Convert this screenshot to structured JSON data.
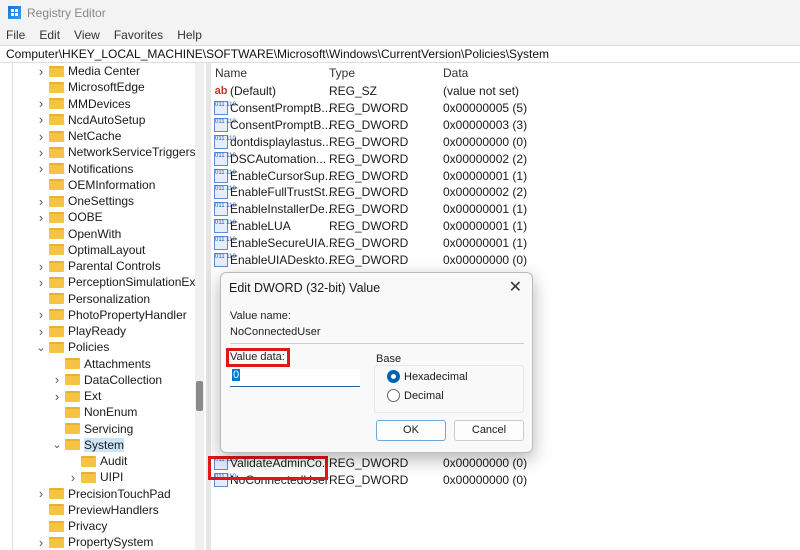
{
  "window": {
    "title": "Registry Editor"
  },
  "menu": [
    "File",
    "Edit",
    "View",
    "Favorites",
    "Help"
  ],
  "address": "Computer\\HKEY_LOCAL_MACHINE\\SOFTWARE\\Microsoft\\Windows\\CurrentVersion\\Policies\\System",
  "tree": [
    {
      "label": "Media Center",
      "level": 1,
      "chevron": ">"
    },
    {
      "label": "MicrosoftEdge",
      "level": 1,
      "chevron": ""
    },
    {
      "label": "MMDevices",
      "level": 1,
      "chevron": ">"
    },
    {
      "label": "NcdAutoSetup",
      "level": 1,
      "chevron": ">"
    },
    {
      "label": "NetCache",
      "level": 1,
      "chevron": ">"
    },
    {
      "label": "NetworkServiceTriggers",
      "level": 1,
      "chevron": ">"
    },
    {
      "label": "Notifications",
      "level": 1,
      "chevron": ">"
    },
    {
      "label": "OEMInformation",
      "level": 1,
      "chevron": ""
    },
    {
      "label": "OneSettings",
      "level": 1,
      "chevron": ">"
    },
    {
      "label": "OOBE",
      "level": 1,
      "chevron": ">"
    },
    {
      "label": "OpenWith",
      "level": 1,
      "chevron": ""
    },
    {
      "label": "OptimalLayout",
      "level": 1,
      "chevron": ""
    },
    {
      "label": "Parental Controls",
      "level": 1,
      "chevron": ">"
    },
    {
      "label": "PerceptionSimulationExt",
      "level": 1,
      "chevron": ">"
    },
    {
      "label": "Personalization",
      "level": 1,
      "chevron": ""
    },
    {
      "label": "PhotoPropertyHandler",
      "level": 1,
      "chevron": ">"
    },
    {
      "label": "PlayReady",
      "level": 1,
      "chevron": ">"
    },
    {
      "label": "Policies",
      "level": 1,
      "chevron": "v"
    },
    {
      "label": "Attachments",
      "level": 2,
      "chevron": ""
    },
    {
      "label": "DataCollection",
      "level": 2,
      "chevron": ">"
    },
    {
      "label": "Ext",
      "level": 2,
      "chevron": ">"
    },
    {
      "label": "NonEnum",
      "level": 2,
      "chevron": ""
    },
    {
      "label": "Servicing",
      "level": 2,
      "chevron": ""
    },
    {
      "label": "System",
      "level": 2,
      "chevron": "v",
      "selected": true
    },
    {
      "label": "Audit",
      "level": 3,
      "chevron": ""
    },
    {
      "label": "UIPI",
      "level": 3,
      "chevron": ">"
    },
    {
      "label": "PrecisionTouchPad",
      "level": 1,
      "chevron": ">"
    },
    {
      "label": "PreviewHandlers",
      "level": 1,
      "chevron": ""
    },
    {
      "label": "Privacy",
      "level": 1,
      "chevron": ""
    },
    {
      "label": "PropertySystem",
      "level": 1,
      "chevron": ">"
    }
  ],
  "list": {
    "headers": {
      "name": "Name",
      "type": "Type",
      "data": "Data"
    },
    "rows": [
      {
        "name": "(Default)",
        "type": "REG_SZ",
        "data": "(value not set)",
        "icon": "sz"
      },
      {
        "name": "ConsentPromptB...",
        "type": "REG_DWORD",
        "data": "0x00000005 (5)",
        "icon": "dw"
      },
      {
        "name": "ConsentPromptB...",
        "type": "REG_DWORD",
        "data": "0x00000003 (3)",
        "icon": "dw"
      },
      {
        "name": "dontdisplaylastus...",
        "type": "REG_DWORD",
        "data": "0x00000000 (0)",
        "icon": "dw"
      },
      {
        "name": "DSCAutomation...",
        "type": "REG_DWORD",
        "data": "0x00000002 (2)",
        "icon": "dw"
      },
      {
        "name": "EnableCursorSup...",
        "type": "REG_DWORD",
        "data": "0x00000001 (1)",
        "icon": "dw"
      },
      {
        "name": "EnableFullTrustSt...",
        "type": "REG_DWORD",
        "data": "0x00000002 (2)",
        "icon": "dw"
      },
      {
        "name": "EnableInstallerDe...",
        "type": "REG_DWORD",
        "data": "0x00000001 (1)",
        "icon": "dw"
      },
      {
        "name": "EnableLUA",
        "type": "REG_DWORD",
        "data": "0x00000001 (1)",
        "icon": "dw"
      },
      {
        "name": "EnableSecureUIA...",
        "type": "REG_DWORD",
        "data": "0x00000001 (1)",
        "icon": "dw"
      },
      {
        "name": "EnableUIADeskto...",
        "type": "REG_DWORD",
        "data": "0x00000000 (0)",
        "icon": "dw"
      },
      {
        "name": "ValidateAdminCo...",
        "type": "REG_DWORD",
        "data": "0x00000000 (0)",
        "icon": "dw",
        "row": 22
      },
      {
        "name": "NoConnectedUser",
        "type": "REG_DWORD",
        "data": "0x00000000 (0)",
        "icon": "dw",
        "row": 23
      }
    ]
  },
  "dialog": {
    "title": "Edit DWORD (32-bit) Value",
    "value_name_label": "Value name:",
    "value_name": "NoConnectedUser",
    "value_data_label": "Value data:",
    "value_data": "0",
    "base_label": "Base",
    "hex_label": "Hexadecimal",
    "dec_label": "Decimal",
    "selected_base": "Hexadecimal",
    "ok": "OK",
    "cancel": "Cancel"
  },
  "highlight_color": "#e0161b"
}
